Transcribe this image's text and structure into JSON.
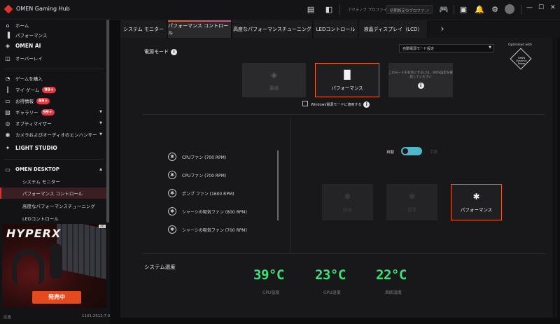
{
  "app": {
    "title": "OMEN Gaming Hub"
  },
  "titlebar": {
    "profile_label": "アクティブ プロファイル",
    "profile_value": "初期設定のプロファ...",
    "icons": [
      "library-icon",
      "omen-cube-icon",
      "controller-icon",
      "monitor-user-icon",
      "bell-icon",
      "gear-icon",
      "avatar"
    ]
  },
  "sidebar": {
    "top_items": [
      {
        "label": "ホーム",
        "icon": "home-icon"
      },
      {
        "label": "パフォーマンス",
        "icon": "performance-icon"
      },
      {
        "label": "OMEN AI",
        "icon": "omen-ai-icon"
      },
      {
        "label": "オーバーレイ",
        "icon": "overlay-icon"
      }
    ],
    "mid_items": [
      {
        "label": "ゲームを購入",
        "icon": "tag-icon"
      },
      {
        "label": "マイ ゲーム",
        "icon": "library-icon",
        "badge": "99+"
      },
      {
        "label": "お得情報",
        "icon": "ticket-icon",
        "badge": "99+"
      },
      {
        "label": "ギャラリー",
        "icon": "gallery-icon",
        "badge": "99+"
      },
      {
        "label": "オプティマイザー",
        "icon": "optimizer-icon"
      },
      {
        "label": "カメラおよびオーディオのエンハンサー",
        "icon": "camera-audio-icon"
      },
      {
        "label": "LIGHT STUDIO",
        "icon": "sparkle-icon"
      }
    ],
    "device": {
      "label": "OMEN DESKTOP",
      "icon": "desktop-icon"
    },
    "sub_items": [
      {
        "label": "システム モニター"
      },
      {
        "label": "パフォーマンス コントロール"
      },
      {
        "label": "高度なパフォーマンスチューニング"
      },
      {
        "label": "LEDコントロール"
      }
    ],
    "ad": {
      "brand": "HYPERX",
      "cta": "発売中",
      "tag": "AD",
      "label": "広告"
    },
    "version": "1101.2512.7.0"
  },
  "tabs": [
    {
      "label": "システム モニター"
    },
    {
      "label": "パフォーマンス コントロール",
      "active": true
    },
    {
      "label": "高度なパフォーマンスチューニング"
    },
    {
      "label": "LEDコントロール"
    },
    {
      "label": "液晶ディスプレイ（LCD）"
    }
  ],
  "power": {
    "label": "電源モード",
    "select_value": "自動電源モード設定",
    "optimized_label": "Optimized with",
    "badge_text": "OMEN Dynamic Power",
    "cards": [
      {
        "label": "最適",
        "icon": "omen-diamond-icon"
      },
      {
        "label": "パフォーマンス",
        "icon": "performance-bars-icon",
        "selected": true
      },
      {
        "label": "このモードを有効にするには、BIOS設定を確認してください"
      }
    ],
    "windows_checkbox_label": "Windows電源モードに適用する"
  },
  "fans": {
    "rows": [
      {
        "label": "CPUファン (700 RPM)"
      },
      {
        "label": "CPUファン (700 RPM)"
      },
      {
        "label": "ポンプ ファン (1600 RPM)"
      },
      {
        "label": "シャーシの吸気ファン (800 RPM)"
      },
      {
        "label": "シャーシの吸気ファン (700 RPM)"
      }
    ],
    "auto_label": "自動",
    "manual_label": "手動",
    "mode_cards": [
      {
        "label": "静音"
      },
      {
        "label": "標準"
      },
      {
        "label": "パフォーマンス",
        "selected": true
      }
    ]
  },
  "temps": {
    "label": "システム温度",
    "items": [
      {
        "value": "39°C",
        "label": "CPU温度"
      },
      {
        "value": "23°C",
        "label": "GPU温度"
      },
      {
        "value": "22°C",
        "label": "周囲温度"
      }
    ],
    "color": "#3ee07a"
  },
  "colors": {
    "accent": "#e0322d",
    "tab_gradient_start": "#e85d2a",
    "tab_gradient_end": "#d04e9a",
    "toggle": "#4fb8c8"
  }
}
